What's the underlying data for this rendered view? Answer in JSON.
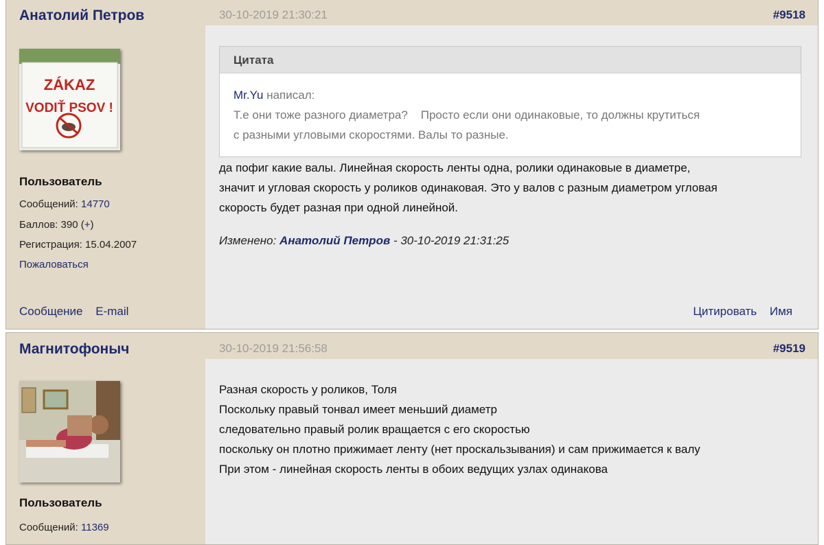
{
  "posts": [
    {
      "author": "Анатолий Петров",
      "avatar_text_line1": "ZÁKAZ",
      "avatar_text_line2": "VODIŤ PSOV !",
      "role": "Пользователь",
      "messages_label": "Сообщений:",
      "messages_count": "14770",
      "points_label": "Баллов: 390 (",
      "points_plus": "+",
      "points_close": ")",
      "registration": "Регистрация: 15.04.2007",
      "complain": "Пожаловаться",
      "message_link": "Сообщение",
      "email_link": "E-mail",
      "date": "30-10-2019 21:30:21",
      "number": "#9518",
      "quote": {
        "header": "Цитата",
        "author": "Mr.Yu",
        "wrote": " написал:",
        "lines": [
          "Т.е они тоже разного диаметра?    Просто если они одинаковые, то должны крутиться",
          "с разными угловыми скоростями. Валы то разные."
        ]
      },
      "text_lines": [
        "да пофиг какие валы. Линейная скорость ленты одна, ролики одинаковые в диаметре,",
        "значит и угловая скорость у роликов одинаковая. Это у валов с разным диаметром угловая",
        "скорость будет разная при одной линейной."
      ],
      "edited_prefix": "Изменено: ",
      "edited_author": "Анатолий Петров",
      "edited_suffix": " - 30-10-2019 21:31:25",
      "quote_action": "Цитировать",
      "name_action": "Имя"
    },
    {
      "author": "Магнитофоныч",
      "role": "Пользователь",
      "messages_label": "Сообщений:",
      "messages_count": "11369",
      "date": "30-10-2019 21:56:58",
      "number": "#9519",
      "text_lines": [
        "Разная скорость у роликов, Толя",
        "Поскольку правый тонвал имеет меньший диаметр",
        "следовательно правый ролик вращается с его скоростью",
        "поскольку он плотно прижимает ленту (нет проскальзывания) и сам прижимается к валу",
        "При этом - линейная скорость ленты в обоих ведущих узлах одинакова"
      ]
    }
  ],
  "colors": {
    "link": "#1e2a6e",
    "sidebar_bg": "#e3d9c8",
    "body_bg": "#ebebeb",
    "date": "#9c9c9c"
  }
}
